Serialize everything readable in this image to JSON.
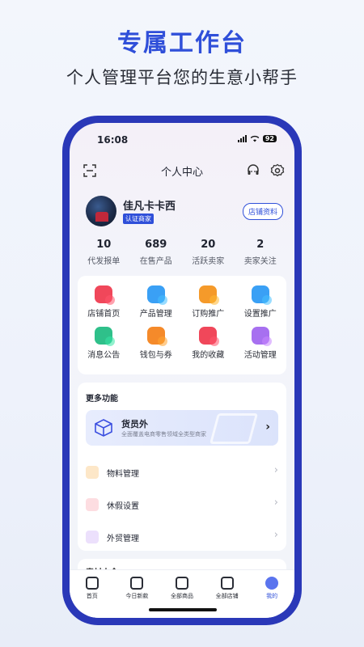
{
  "promo": {
    "headline": "专属工作台",
    "subline": "个人管理平台您的生意小帮手"
  },
  "status_bar": {
    "time": "16:08",
    "battery": "92"
  },
  "nav": {
    "title": "个人中心"
  },
  "profile": {
    "name": "佳凡卡卡西",
    "badge": "认证商家",
    "store_button": "店铺资料"
  },
  "stats": [
    {
      "value": "10",
      "label": "代发报单"
    },
    {
      "value": "689",
      "label": "在售产品"
    },
    {
      "value": "20",
      "label": "活跃卖家"
    },
    {
      "value": "2",
      "label": "卖家关注"
    }
  ],
  "grid": [
    {
      "label": "店铺首页",
      "icon": "store-home-icon",
      "color": "#f0475a"
    },
    {
      "label": "产品管理",
      "icon": "product-icon",
      "color": "#3aa0f5"
    },
    {
      "label": "订购推广",
      "icon": "promote-icon",
      "color": "#f59a2a"
    },
    {
      "label": "设置推广",
      "icon": "setting-promo-icon",
      "color": "#3aa0f5"
    },
    {
      "label": "消息公告",
      "icon": "message-icon",
      "color": "#2fc08a"
    },
    {
      "label": "钱包与券",
      "icon": "wallet-icon",
      "color": "#f58a2a"
    },
    {
      "label": "我的收藏",
      "icon": "favorite-icon",
      "color": "#f0475a"
    },
    {
      "label": "活动管理",
      "icon": "activity-icon",
      "color": "#a770f0"
    }
  ],
  "more": {
    "title": "更多功能",
    "banner_title": "货员外",
    "banner_sub": "全面覆盖电商零售领域全类型商家",
    "rows": [
      {
        "label": "物料管理",
        "icon": "materials-icon",
        "color": "#f5a02a"
      },
      {
        "label": "休假设置",
        "icon": "vacation-icon",
        "color": "#f0475a"
      },
      {
        "label": "外贸管理",
        "icon": "trade-icon",
        "color": "#a770f0"
      }
    ]
  },
  "peek": {
    "title": "素材大全"
  },
  "tabs": [
    {
      "label": "首页",
      "icon": "home-icon"
    },
    {
      "label": "今日新款",
      "icon": "new-icon"
    },
    {
      "label": "全部商品",
      "icon": "bag-icon"
    },
    {
      "label": "全部店铺",
      "icon": "shop-icon"
    },
    {
      "label": "我的",
      "icon": "user-icon"
    }
  ]
}
